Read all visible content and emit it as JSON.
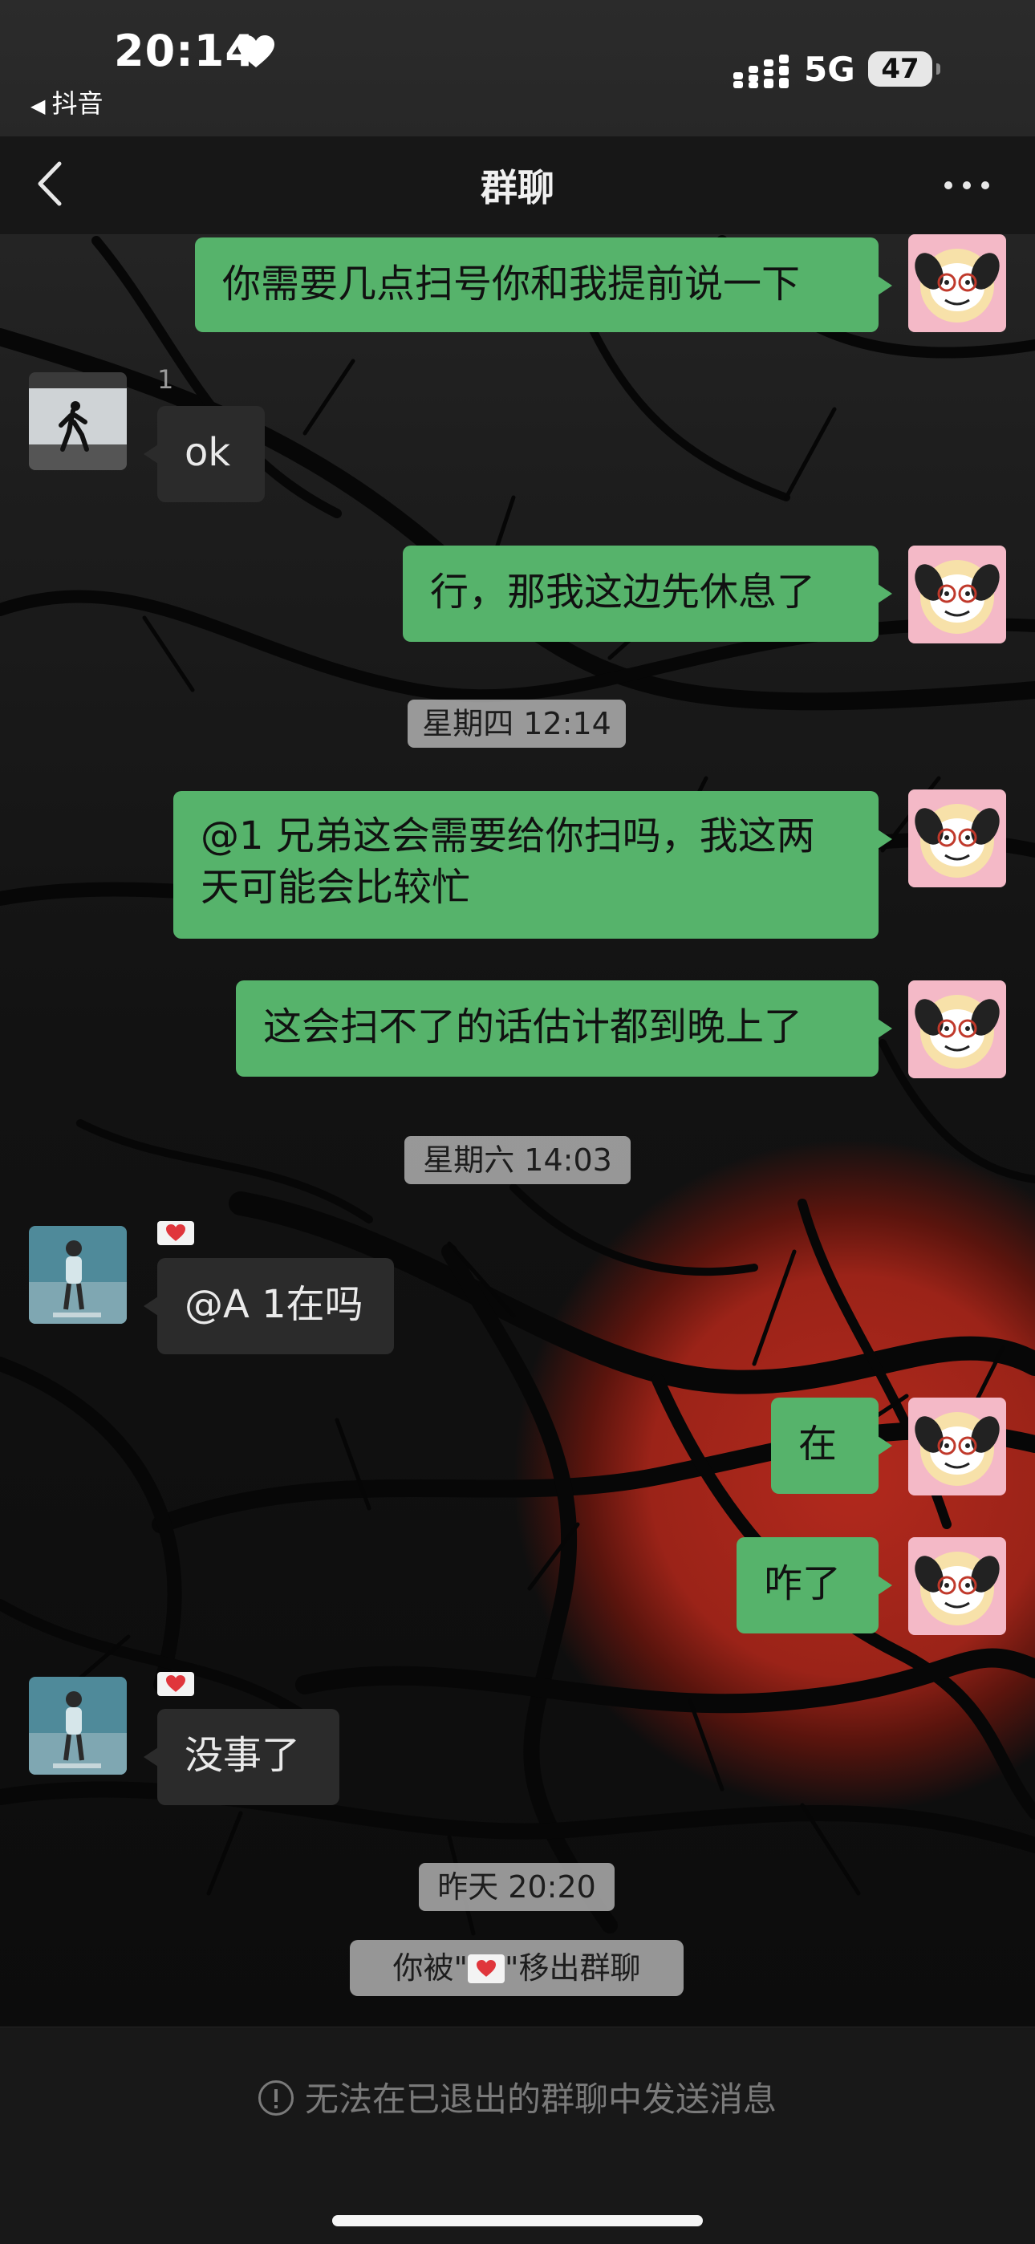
{
  "status_bar": {
    "time": "20:14",
    "back_app": "抖音",
    "network": "5G",
    "battery": "47"
  },
  "nav": {
    "title": "群聊"
  },
  "messages": [
    {
      "side": "out",
      "text": "你需要几点扫号你和我提前说一下"
    },
    {
      "side": "in",
      "sender": "1",
      "text": "ok"
    },
    {
      "side": "out",
      "text": "行，那我这边先休息了"
    },
    {
      "type": "time",
      "text": "星期四 12:14"
    },
    {
      "side": "out",
      "lines": [
        "@1 兄弟这会需要给你扫吗，我这两",
        "天可能会比较忙"
      ]
    },
    {
      "side": "out",
      "text": "这会扫不了的话估计都到晚上了"
    },
    {
      "type": "time",
      "text": "星期六 14:03"
    },
    {
      "side": "in",
      "sender_badge": "heart",
      "text": "@A 1在吗"
    },
    {
      "side": "out",
      "text": "在"
    },
    {
      "side": "out",
      "text": "咋了"
    },
    {
      "side": "in",
      "sender_badge": "heart",
      "text": "没事了"
    },
    {
      "type": "time",
      "text": "昨天 20:20"
    }
  ],
  "system_notice": {
    "prefix": "你被\"",
    "suffix": "\"移出群聊"
  },
  "footer": {
    "notice": "无法在已退出的群聊中发送消息"
  },
  "colors": {
    "outgoing_bubble": "#56b36b",
    "incoming_bubble": "#2b2b2b",
    "moon": "#b2291d"
  }
}
